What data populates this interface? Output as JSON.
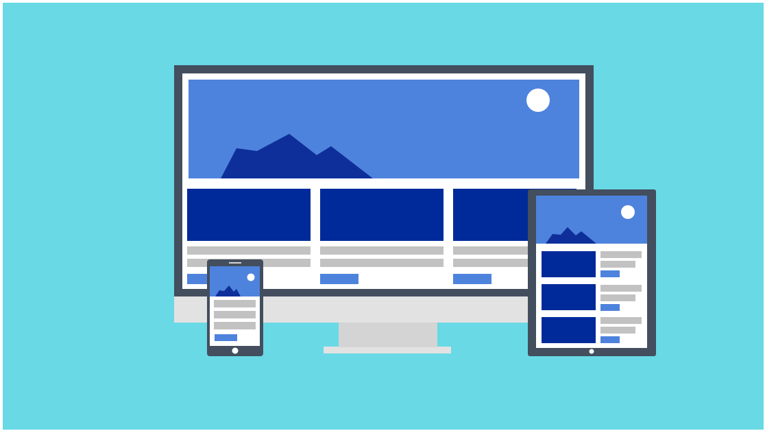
{
  "scene": {
    "subject": "responsive-design-illustration",
    "devices": [
      "desktop-monitor",
      "tablet",
      "smartphone"
    ],
    "icons": {
      "mountain": "mountain-icon",
      "sun": "sun-icon",
      "home_button": "home-button-icon"
    }
  },
  "colors": {
    "background": "#68d9e5",
    "bezel": "#434e5e",
    "screen": "#ffffff",
    "hero": "#4e83dd",
    "mountain": "#0e2f9a",
    "card": "#002a9a",
    "text_line": "#c2c2c2",
    "button": "#4e83dd",
    "stand": "#d4d4d4",
    "stand_base": "#e2e2e2",
    "sun": "#ffffff"
  }
}
